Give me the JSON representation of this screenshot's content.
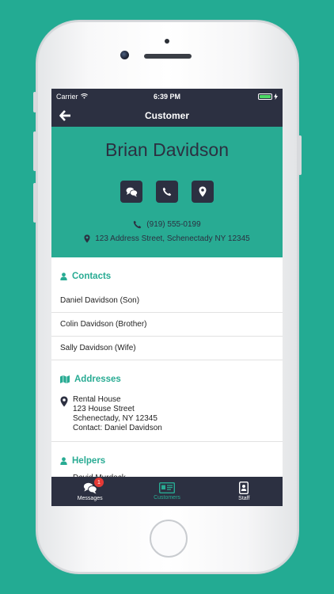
{
  "status_bar": {
    "carrier": "Carrier",
    "time": "6:39 PM"
  },
  "nav": {
    "title": "Customer"
  },
  "customer": {
    "name": "Brian Davidson",
    "phone": "(919) 555-0199",
    "address": "123 Address Street, Schenectady NY 12345"
  },
  "actions": [
    {
      "icon": "chat-icon"
    },
    {
      "icon": "phone-icon"
    },
    {
      "icon": "map-marker-icon"
    }
  ],
  "contacts": {
    "title": "Contacts",
    "items": [
      "Daniel Davidson (Son)",
      "Colin Davidson (Brother)",
      "Sally Davidson (Wife)"
    ]
  },
  "addresses": {
    "title": "Addresses",
    "items": [
      {
        "name": "Rental House",
        "street": "123 House Street",
        "city": "Schenectady, NY 12345",
        "contact": "Contact: Daniel Davidson"
      }
    ]
  },
  "helpers": {
    "title": "Helpers",
    "partial_item": "David Murdock"
  },
  "tabs": [
    {
      "label": "Messages",
      "badge": "1",
      "icon": "chat-icon",
      "active": false
    },
    {
      "label": "Customers",
      "icon": "id-card-icon",
      "active": true
    },
    {
      "label": "Staff",
      "icon": "badge-icon",
      "active": false
    }
  ],
  "colors": {
    "accent": "#28ab93",
    "dark": "#2c3041",
    "badge": "#e53935",
    "background": "#23ab93"
  }
}
